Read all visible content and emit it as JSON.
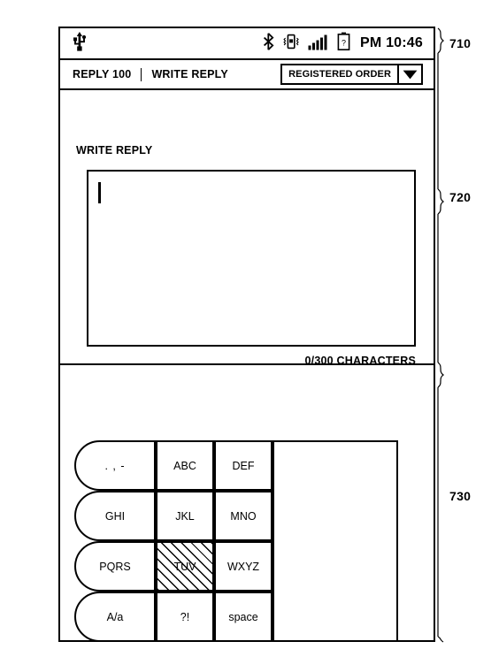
{
  "figure": {
    "reference_numerals": [
      {
        "id": "710",
        "label": "710",
        "target": "status-and-title-bar"
      },
      {
        "id": "720",
        "label": "720",
        "target": "compose-reply-area"
      },
      {
        "id": "730",
        "label": "730",
        "target": "keypad-area"
      }
    ]
  },
  "status_bar": {
    "left_icons": [
      {
        "name": "usb-icon",
        "glyph": "usb"
      }
    ],
    "right_icons": [
      {
        "name": "bluetooth-icon",
        "glyph": "bluetooth"
      },
      {
        "name": "vibrate-icon",
        "glyph": "vibrate"
      },
      {
        "name": "signal-strength-icon",
        "glyph": "signal",
        "bars": 5
      },
      {
        "name": "battery-icon",
        "glyph": "battery"
      }
    ],
    "clock": "PM 10:46"
  },
  "title_bar": {
    "tabs": [
      {
        "label": "REPLY 100"
      },
      {
        "label": "WRITE REPLY"
      }
    ],
    "separator": "|",
    "sort_dropdown": {
      "value": "REGISTERED ORDER",
      "arrow": "chevron-down",
      "options": [
        "REGISTERED ORDER"
      ]
    }
  },
  "compose": {
    "heading": "WRITE REPLY",
    "textarea": {
      "value": "",
      "placeholder": "",
      "caret_visible": true
    },
    "character_counter": "0/300 CHARACTERS",
    "max_characters": 300,
    "current_characters": 0
  },
  "keypad": {
    "rows": [
      [
        {
          "label": ". , -",
          "name": "key-punctuation",
          "selected": false,
          "wide": true
        },
        {
          "label": "ABC",
          "name": "key-abc",
          "selected": false
        },
        {
          "label": "DEF",
          "name": "key-def",
          "selected": false
        }
      ],
      [
        {
          "label": "GHI",
          "name": "key-ghi",
          "selected": false,
          "wide": true
        },
        {
          "label": "JKL",
          "name": "key-jkl",
          "selected": false
        },
        {
          "label": "MNO",
          "name": "key-mno",
          "selected": false
        }
      ],
      [
        {
          "label": "PQRS",
          "name": "key-pqrs",
          "selected": false,
          "wide": true
        },
        {
          "label": "TUV",
          "name": "key-tuv",
          "selected": true
        },
        {
          "label": "WXYZ",
          "name": "key-wxyz",
          "selected": false
        }
      ],
      [
        {
          "label": "A/a",
          "name": "key-case-toggle",
          "selected": false,
          "wide": true
        },
        {
          "label": "?!",
          "name": "key-symbols",
          "selected": false
        },
        {
          "label": "space",
          "name": "key-space",
          "selected": false
        }
      ]
    ],
    "side_panel": {
      "name": "candidate-panel",
      "content": ""
    }
  },
  "colors": {
    "line": "#000000",
    "background": "#ffffff",
    "selected_hatch": "#000000"
  }
}
